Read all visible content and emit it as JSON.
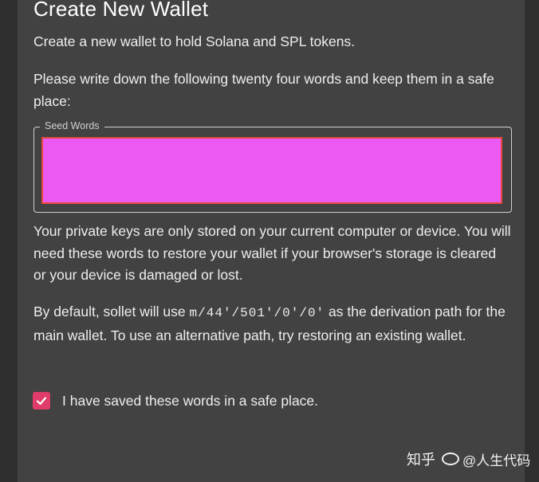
{
  "dialog": {
    "title": "Create New Wallet",
    "intro": "Create a new wallet to hold Solana and SPL tokens.",
    "instruction": "Please write down the following twenty four words and keep them in a safe place:"
  },
  "seed_field": {
    "legend": "Seed Words",
    "value": ""
  },
  "warning": "Your private keys are only stored on your current computer or device. You will need these words to restore your wallet if your browser's storage is cleared or your device is damaged or lost.",
  "derivation": {
    "before": "By default, sollet will use ",
    "path": "m/44'/501'/0'/0'",
    "after": " as the derivation path for the main wallet. To use an alternative path, try restoring an existing wallet."
  },
  "confirm": {
    "label": "I have saved these words in a safe place.",
    "checked": true
  },
  "watermark": {
    "brand": "知乎",
    "author": "@人生代码"
  },
  "colors": {
    "card_bg": "#424242",
    "page_bg": "#2f2f2f",
    "seed_highlight": "#ea5af3",
    "seed_border": "#e8493c",
    "checkbox": "#e03c6a"
  }
}
